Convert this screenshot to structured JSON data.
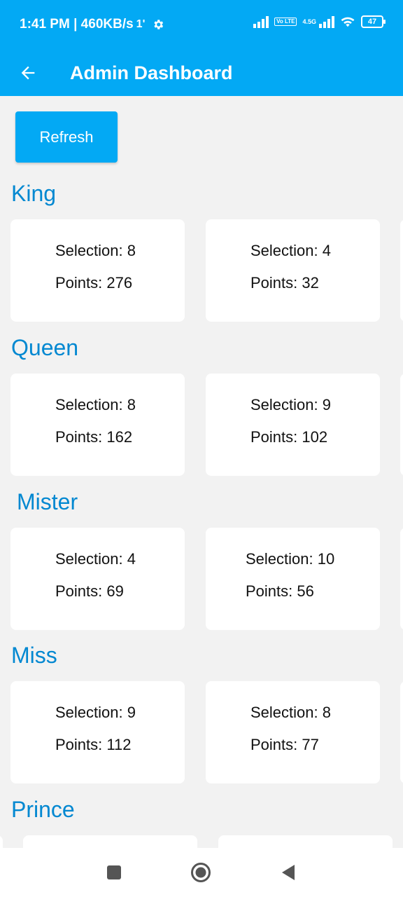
{
  "status": {
    "time_speed": "1:41 PM | 460KB/s",
    "alert_glyph": "1'",
    "network": "4.5G",
    "volte": "Vo LTE",
    "battery": "47"
  },
  "appbar": {
    "title": "Admin Dashboard"
  },
  "refresh_label": "Refresh",
  "sections": [
    {
      "title": "King",
      "cards": [
        {
          "selection": "Selection: 8",
          "points": "Points: 276"
        },
        {
          "selection": "Selection: 4",
          "points": "Points: 32"
        }
      ]
    },
    {
      "title": "Queen",
      "cards": [
        {
          "selection": "Selection: 8",
          "points": "Points: 162"
        },
        {
          "selection": "Selection: 9",
          "points": "Points: 102"
        }
      ]
    },
    {
      "title": "Mister",
      "cards": [
        {
          "selection": "Selection: 4",
          "points": "Points: 69"
        },
        {
          "selection": "Selection: 10",
          "points": "Points: 56"
        }
      ]
    },
    {
      "title": "Miss",
      "cards": [
        {
          "selection": "Selection: 9",
          "points": "Points: 112"
        },
        {
          "selection": "Selection: 8",
          "points": "Points: 77"
        }
      ]
    },
    {
      "title": "Prince"
    }
  ],
  "icons": {
    "back": "arrow-left-icon",
    "settings": "gear-icon",
    "nav_recent": "square-icon",
    "nav_home": "circle-icon",
    "nav_back": "triangle-back-icon"
  },
  "colors": {
    "primary": "#03a9f4",
    "section_title": "#0288d1",
    "background": "#f2f2f2"
  }
}
